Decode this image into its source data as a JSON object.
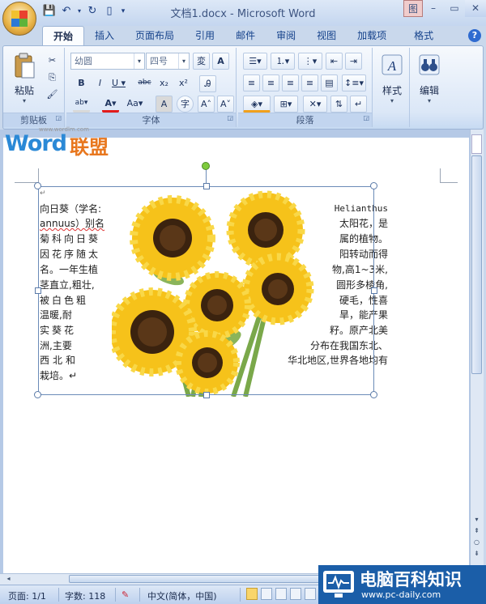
{
  "window": {
    "title": "文档1.docx - Microsoft Word",
    "image_tab": "图",
    "minimize": "–",
    "maximize": "▭",
    "close": "✕"
  },
  "ribbon_tabs": [
    "开始",
    "插入",
    "页面布局",
    "引用",
    "邮件",
    "审阅",
    "视图",
    "加载项",
    "格式"
  ],
  "groups": {
    "clipboard": {
      "label": "剪贴板",
      "paste": "粘贴"
    },
    "font": {
      "label": "字体",
      "font_name": "幼圆",
      "font_size": "四号"
    },
    "paragraph": {
      "label": "段落"
    },
    "styles": {
      "label": "样式"
    },
    "editing": {
      "label": "编辑"
    }
  },
  "watermark": {
    "url": "www.wordlm.com",
    "word": "Word",
    "cn": "联盟"
  },
  "document": {
    "para_mark": "↵",
    "left_lines": [
      "向日葵（学名:",
      "annuus）别名",
      "菊科向日葵",
      "因花序随太",
      "名。一年生植",
      "茎直立,粗壮,",
      "被白色粗",
      "温暖,耐",
      "实葵花",
      "洲,主要",
      "西北和",
      "栽培。↵"
    ],
    "right_lines": [
      "Helianthus",
      "太阳花，是",
      "属的植物。",
      "阳转动而得",
      "物,高1~3米,",
      "圆形多棱角,",
      "硬毛，性喜",
      "旱，能产果",
      "籽。原产北美",
      "分布在我国东北、",
      "华北地区,世界各地均有"
    ]
  },
  "status": {
    "page": "页面: 1/1",
    "words": "字数: 118",
    "lang": "中文(简体，中国)"
  },
  "logo": {
    "cn": "电脑百科知识",
    "url": "www.pc-daily.com"
  }
}
